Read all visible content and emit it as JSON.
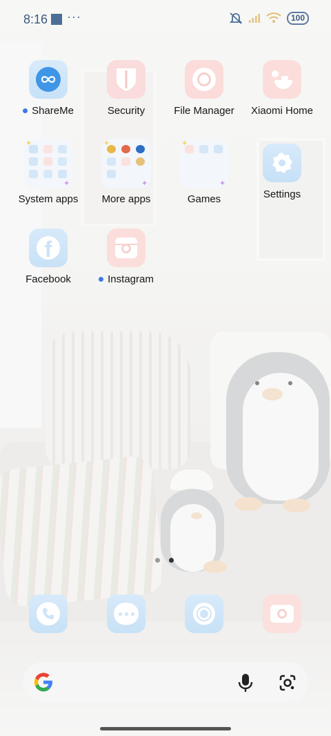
{
  "status_bar": {
    "time": "8:16",
    "dots": "···",
    "battery": "100"
  },
  "home_grid": [
    {
      "label": "ShareMe",
      "dot": true,
      "icon": "shareme-icon"
    },
    {
      "label": "Security",
      "dot": false,
      "icon": "security-shield-icon"
    },
    {
      "label": "File Manager",
      "dot": false,
      "icon": "file-manager-icon"
    },
    {
      "label": "Xiaomi Home",
      "dot": false,
      "icon": "xiaomi-home-icon"
    },
    {
      "label": "System apps",
      "dot": false,
      "icon": "folder-icon"
    },
    {
      "label": "More apps",
      "dot": false,
      "icon": "folder-icon"
    },
    {
      "label": "Games",
      "dot": false,
      "icon": "folder-icon"
    },
    {
      "label": "Settings",
      "dot": false,
      "icon": "settings-gear-icon"
    },
    {
      "label": "Facebook",
      "dot": false,
      "icon": "facebook-icon"
    },
    {
      "label": "Instagram",
      "dot": true,
      "icon": "instagram-icon"
    }
  ],
  "page_indicator": {
    "pages": 2,
    "current": 2
  },
  "dock": [
    "phone-icon",
    "messages-icon",
    "chrome-icon",
    "camera-icon"
  ],
  "search_bar": {
    "logo": "G",
    "mic": "mic-icon",
    "lens": "google-lens-icon"
  },
  "colors": {
    "accent_dot": "#3b7ae8",
    "status": "#4c6d98"
  }
}
